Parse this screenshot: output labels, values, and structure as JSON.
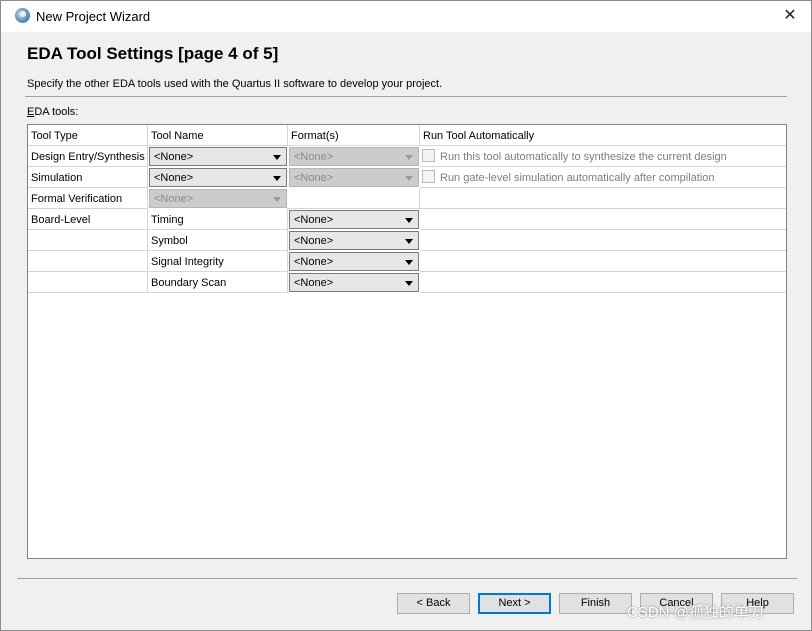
{
  "window": {
    "title": "New Project Wizard",
    "close_glyph": "✕"
  },
  "page": {
    "heading": "EDA Tool Settings [page 4 of 5]",
    "description": "Specify the other EDA tools used with the Quartus II software to develop your project.",
    "eda_label_prefix": "E",
    "eda_label_rest": "DA tools:"
  },
  "table": {
    "headers": [
      "Tool Type",
      "Tool Name",
      "Format(s)",
      "Run Tool Automatically"
    ],
    "rows": [
      {
        "type": "Design Entry/Synthesis",
        "tool": "<None>",
        "format": "<None>",
        "auto": "Run this tool automatically to synthesize the current design"
      },
      {
        "type": "Simulation",
        "tool": "<None>",
        "format": "<None>",
        "auto": "Run gate-level simulation automatically after compilation"
      },
      {
        "type": "Formal Verification",
        "tool": "<None>"
      },
      {
        "type": "Board-Level",
        "tool": "Timing",
        "format": "<None>"
      },
      {
        "type": "",
        "tool": "Symbol",
        "format": "<None>"
      },
      {
        "type": "",
        "tool": "Signal Integrity",
        "format": "<None>"
      },
      {
        "type": "",
        "tool": "Boundary Scan",
        "format": "<None>"
      }
    ]
  },
  "buttons": {
    "back": "< Back",
    "next": "Next >",
    "finish": "Finish",
    "cancel": "Cancel",
    "help": "Help"
  },
  "watermark": "CSDN @孤独的单刀"
}
